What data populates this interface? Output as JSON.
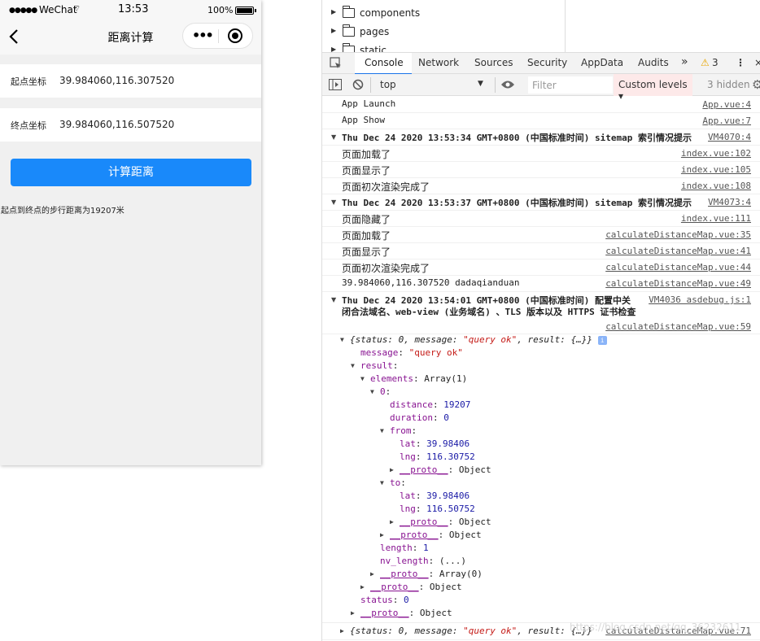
{
  "phone": {
    "status": {
      "signal": "●●●●●",
      "carrier": "WeChat",
      "wifi": "⌔",
      "time": "13:53",
      "battery": "100%"
    },
    "nav": {
      "title": "距离计算",
      "menu_icon": "•••",
      "back_icon": "chevron-left-icon"
    },
    "start": {
      "label": "起点坐标",
      "value": "39.984060,116.307520"
    },
    "end": {
      "label": "终点坐标",
      "value": "39.984060,116.507520"
    },
    "button": "计算距离",
    "result": "起点到终点的步行距离为19207米",
    "accent": "#1989fa"
  },
  "devtools": {
    "tree": [
      {
        "name": "components"
      },
      {
        "name": "pages"
      },
      {
        "name": "static"
      }
    ],
    "tabs": [
      "Console",
      "Network",
      "Sources",
      "Security",
      "AppData",
      "Audits"
    ],
    "overflow": "»",
    "warnings": "3",
    "context": "top",
    "filter_placeholder": "Filter",
    "levels": "Custom levels ▾",
    "hidden": "3 hidden",
    "logs": [
      {
        "text": "App Launch",
        "src": "App.vue:4"
      },
      {
        "text": "App Show",
        "src": "App.vue:7"
      },
      {
        "text": "Thu Dec 24 2020 13:53:34 GMT+0800 (中国标准时间) sitemap 索引情况提示",
        "src": "VM4070:4"
      },
      {
        "text": "页面加载了",
        "src": "index.vue:102"
      },
      {
        "text": "页面显示了",
        "src": "index.vue:105"
      },
      {
        "text": "页面初次渲染完成了",
        "src": "index.vue:108"
      },
      {
        "text": "Thu Dec 24 2020 13:53:37 GMT+0800 (中国标准时间) sitemap 索引情况提示",
        "src": "VM4073:4"
      },
      {
        "text": "页面隐藏了",
        "src": "index.vue:111"
      },
      {
        "text": "页面加载了",
        "src": "calculateDistanceMap.vue:35"
      },
      {
        "text": "页面显示了",
        "src": "calculateDistanceMap.vue:41"
      },
      {
        "text": "页面初次渲染完成了",
        "src": "calculateDistanceMap.vue:44"
      },
      {
        "text": "39.984060,116.307520 dadaqianduan",
        "src": "calculateDistanceMap.vue:49"
      },
      {
        "text": "Thu Dec 24 2020 13:54:01 GMT+0800 (中国标准时间) 配置中关",
        "text2": "闭合法域名、web-view (业务域名) 、TLS 版本以及 HTTPS 证书检查",
        "src": "VM4036 asdebug.js:1"
      },
      {
        "src": "calculateDistanceMap.vue:59"
      },
      {
        "src": "calculateDistanceMap.vue:71"
      }
    ],
    "object": {
      "summary_pre": "{status: 0, message: ",
      "summary_msg": "\"query ok\"",
      "summary_post": ", result: {…}}",
      "message_key": "message",
      "message_val": "\"query ok\"",
      "result_key": "result",
      "elements_key": "elements",
      "elements_val": "Array(1)",
      "idx": "0",
      "distance_key": "distance",
      "distance_val": "19207",
      "duration_key": "duration",
      "duration_val": "0",
      "from_key": "from",
      "lat_key": "lat",
      "lng_key": "lng",
      "from_lat": "39.98406",
      "from_lng": "116.30752",
      "to_key": "to",
      "to_lat": "39.98406",
      "to_lng": "116.50752",
      "proto": "__proto__",
      "proto_obj": "Object",
      "length_key": "length",
      "length_val": "1",
      "nvlen_key": "nv_length",
      "nvlen_val": "(...)",
      "proto_arr": "Array(0)",
      "status_key": "status",
      "status_val": "0"
    },
    "watermark": "https://blog.csdn.net/qq_36232611"
  }
}
